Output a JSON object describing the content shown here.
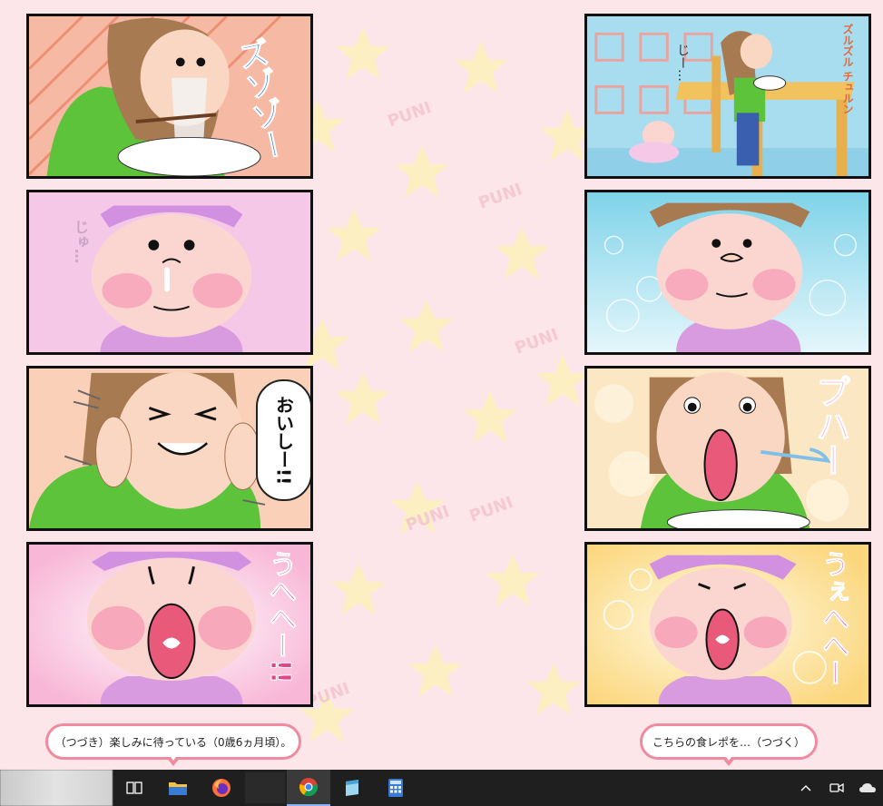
{
  "comic": {
    "left": {
      "panel1_sfx": "ズゾゾー",
      "panel2_sfx": "じゅ…",
      "panel3_speech": "おいしー!!",
      "panel4_sfx": "うへへー!!",
      "caption": "（つづき）楽しみに待っている（0歳6ヵ月頃）。"
    },
    "right": {
      "panel1_sfx": "ズルズル チュルン",
      "panel1_stare": "じー…",
      "panel3_sfx": "プハー",
      "panel4_sfx": "うぇへへー",
      "caption": "こちらの食レポを…（つづく）"
    },
    "background_text": [
      "PUNI",
      "PUNI",
      "PUNI",
      "PUNI",
      "PUNI"
    ]
  },
  "colors": {
    "background": "#fde6ea",
    "caption_border": "#f08aa0",
    "taskbar": "#1f1f1f",
    "sfx_blue": "#4a7fd0",
    "sfx_pink": "#e0458a"
  },
  "taskbar": {
    "items": [
      {
        "name": "task-view",
        "icon": "task-view-icon"
      },
      {
        "name": "file-explorer",
        "icon": "folder-icon"
      },
      {
        "name": "firefox",
        "icon": "firefox-icon"
      },
      {
        "name": "blank-app",
        "icon": "blank-icon"
      },
      {
        "name": "chrome",
        "icon": "chrome-icon"
      },
      {
        "name": "notepad",
        "icon": "notepad-icon"
      },
      {
        "name": "calculator",
        "icon": "calculator-icon"
      }
    ],
    "tray": [
      "chevron-up-icon",
      "meet-now-icon",
      "onedrive-icon"
    ]
  }
}
